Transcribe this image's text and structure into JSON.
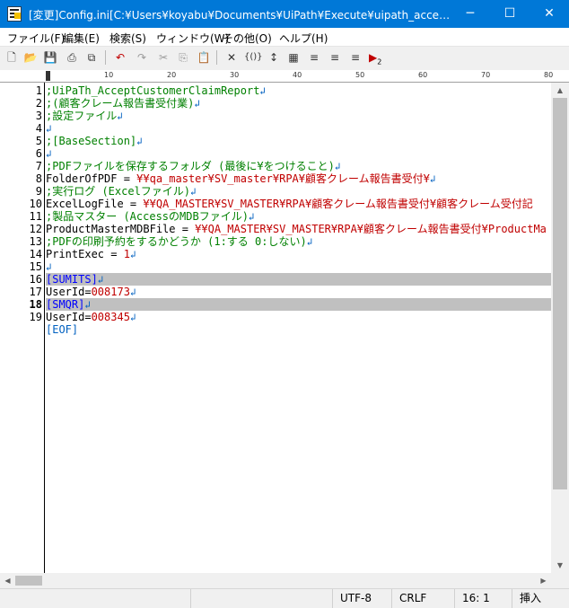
{
  "window": {
    "title": "[変更]Config.ini[C:¥Users¥koyabu¥Documents¥UiPath¥Execute¥uipath_acceptcustome...",
    "minimize": "─",
    "maximize": "☐",
    "close": "✕"
  },
  "menu": [
    {
      "label": "ファイル(F)"
    },
    {
      "label": "編集(E)"
    },
    {
      "label": "検索(S)"
    },
    {
      "label": "ウィンドウ(W)"
    },
    {
      "label": "その他(O)"
    },
    {
      "label": "ヘルプ(H)"
    }
  ],
  "toolbar": {
    "jump_badge": "2"
  },
  "ruler": {
    "labels": [
      "10",
      "20",
      "30",
      "40",
      "50",
      "60",
      "70",
      "80"
    ]
  },
  "editor": {
    "line_numbers": [
      "1",
      "2",
      "3",
      "4",
      "5",
      "6",
      "7",
      "8",
      "9",
      "10",
      "11",
      "12",
      "13",
      "14",
      "15",
      "16",
      "17",
      "18",
      "19"
    ],
    "eof": "[EOF]",
    "lines": {
      "l1": ";UiPaTh_AcceptCustomerClaimReport",
      "l2": ";(顧客クレーム報告書受付業)",
      "l3": ";設定ファイル",
      "l5": ";[BaseSection]",
      "l7": ";PDFファイルを保存するフォルダ (最後に¥をつけること)",
      "l8_key": "FolderOfPDF = ",
      "l8_val": "¥¥qa_master¥SV_master¥RPA¥顧客クレーム報告書受付¥",
      "l9": ";実行ログ (Excelファイル)",
      "l10_key": "ExcelLogFile = ",
      "l10_val": "¥¥QA_MASTER¥SV_MASTER¥RPA¥顧客クレーム報告書受付¥顧客クレーム受付記",
      "l11": ";製品マスター (AccessのMDBファイル)",
      "l12_key": "ProductMasterMDBFile = ",
      "l12_val": "¥¥QA_MASTER¥SV_MASTER¥RPA¥顧客クレーム報告書受付¥ProductMa",
      "l13": ";PDFの印刷予約をするかどうか (1:する 0:しない)",
      "l14_key": "PrintExec = ",
      "l14_val": "1",
      "l16": "[SUMITS]",
      "l17_key": "UserId=",
      "l17_val": "008173",
      "l18": "[SMQR]",
      "l19_key": "UserId=",
      "l19_val": "008345"
    }
  },
  "status": {
    "encoding": "UTF-8",
    "line_ending": "CRLF",
    "position": "16:  1",
    "mode": "挿入"
  }
}
